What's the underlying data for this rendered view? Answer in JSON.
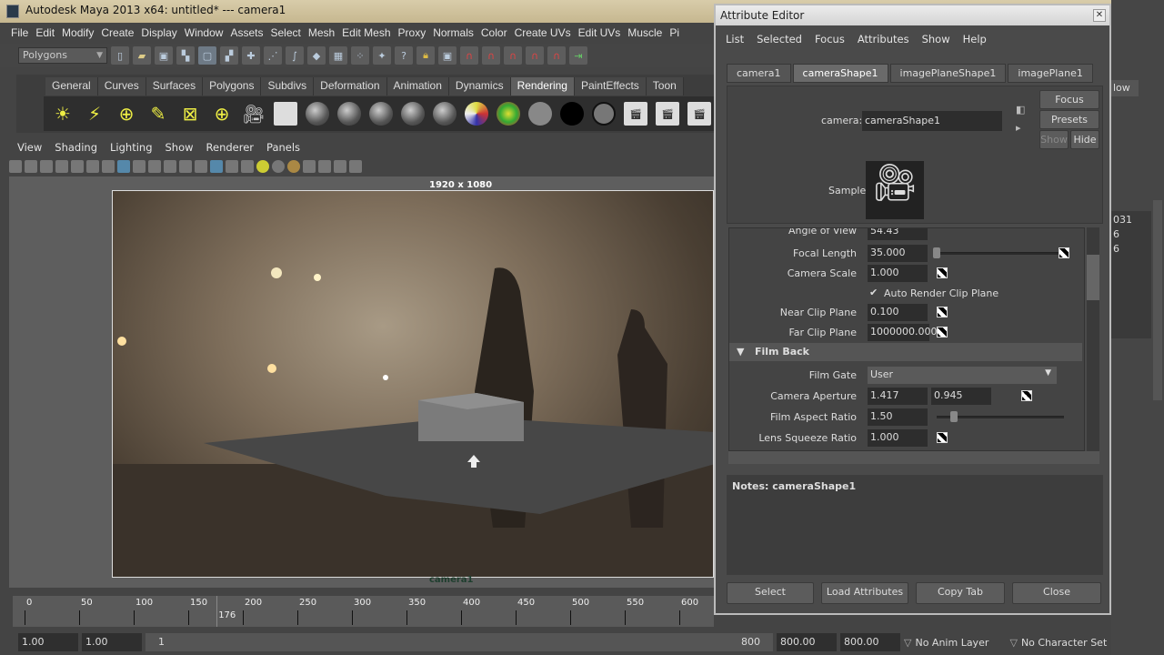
{
  "window": {
    "title": "Autodesk Maya 2013 x64: untitled*   ---   camera1"
  },
  "main_menu": [
    "File",
    "Edit",
    "Modify",
    "Create",
    "Display",
    "Window",
    "Assets",
    "Select",
    "Mesh",
    "Edit Mesh",
    "Proxy",
    "Normals",
    "Color",
    "Create UVs",
    "Edit UVs",
    "Muscle",
    "Pi"
  ],
  "status_line": {
    "mode": "Polygons"
  },
  "shelf": {
    "tabs": [
      "General",
      "Curves",
      "Surfaces",
      "Polygons",
      "Subdivs",
      "Deformation",
      "Animation",
      "Dynamics",
      "Rendering",
      "PaintEffects",
      "Toon"
    ],
    "active": "Rendering"
  },
  "panel": {
    "menu": [
      "View",
      "Shading",
      "Lighting",
      "Show",
      "Renderer",
      "Panels"
    ],
    "resolution_label": "1920 x 1080",
    "camera_label": "camera1"
  },
  "timeline": {
    "ticks": [
      "0",
      "50",
      "100",
      "150",
      "200",
      "250",
      "300",
      "350",
      "400",
      "450",
      "500",
      "550",
      "600"
    ],
    "current_frame": "176"
  },
  "range": {
    "start": "1.00",
    "playback_start": "1.00",
    "slider_start": "1",
    "slider_end": "800",
    "playback_end": "800.00",
    "end": "800.00",
    "anim_layer": "No Anim Layer",
    "character_set": "No Character Set"
  },
  "attribute_editor": {
    "title": "Attribute Editor",
    "menu": [
      "List",
      "Selected",
      "Focus",
      "Attributes",
      "Show",
      "Help"
    ],
    "tabs": [
      "camera1",
      "cameraShape1",
      "imagePlaneShape1",
      "imagePlane1"
    ],
    "active_tab": "cameraShape1",
    "node_label": "camera:",
    "node_value": "cameraShape1",
    "focus": "Focus",
    "presets": "Presets",
    "show": "Show",
    "hide": "Hide",
    "sample_label": "Sample",
    "angle_of_view": {
      "label": "Angle of View",
      "value": "54.43"
    },
    "focal_length": {
      "label": "Focal Length",
      "value": "35.000"
    },
    "camera_scale": {
      "label": "Camera Scale",
      "value": "1.000"
    },
    "auto_render_clip": {
      "label": "Auto Render Clip Plane",
      "checked": true
    },
    "near_clip": {
      "label": "Near Clip Plane",
      "value": "0.100"
    },
    "far_clip": {
      "label": "Far Clip Plane",
      "value": "1000000.000"
    },
    "section": "Film Back",
    "film_gate": {
      "label": "Film Gate",
      "value": "User"
    },
    "camera_aperture": {
      "label": "Camera Aperture",
      "x": "1.417",
      "y": "0.945"
    },
    "film_aspect": {
      "label": "Film Aspect Ratio",
      "value": "1.50"
    },
    "lens_squeeze": {
      "label": "Lens Squeeze Ratio",
      "value": "1.000"
    },
    "notes": "Notes:  cameraShape1",
    "buttons": [
      "Select",
      "Load Attributes",
      "Copy Tab",
      "Close"
    ]
  },
  "right_panel": {
    "values": [
      "031",
      "6",
      "6"
    ],
    "flow": "low"
  }
}
